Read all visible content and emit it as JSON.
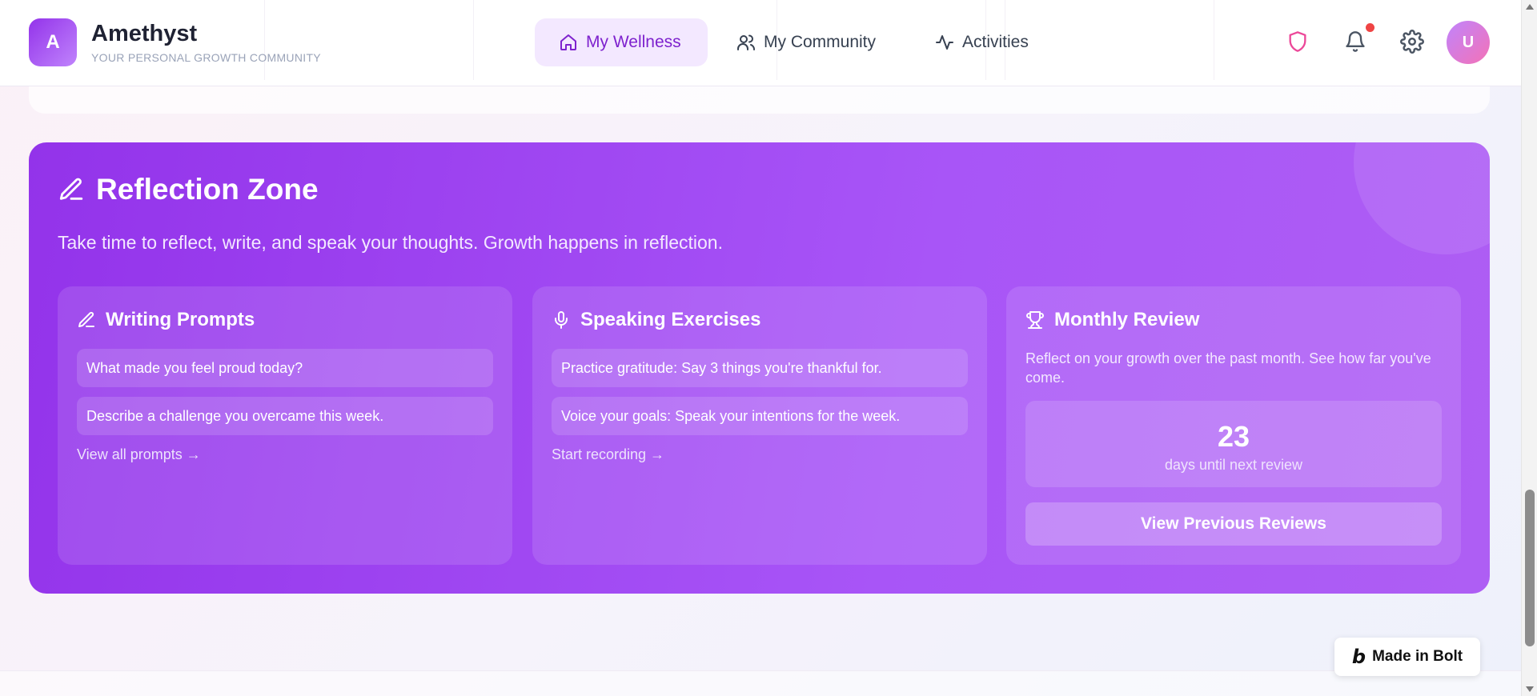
{
  "header": {
    "logo_letter": "A",
    "brand_name": "Amethyst",
    "brand_tagline": "YOUR PERSONAL GROWTH COMMUNITY",
    "nav": [
      {
        "label": "My Wellness",
        "icon": "home-icon",
        "active": true
      },
      {
        "label": "My Community",
        "icon": "users-icon",
        "active": false
      },
      {
        "label": "Activities",
        "icon": "activity-icon",
        "active": false
      }
    ],
    "icons": [
      "shield-icon",
      "bell-icon",
      "gear-icon"
    ],
    "avatar_letter": "U",
    "notification_dot": true
  },
  "reflection_zone": {
    "icon": "pencil-icon",
    "title": "Reflection Zone",
    "subtitle": "Take time to reflect, write, and speak your thoughts. Growth happens in reflection.",
    "cards": {
      "writing": {
        "icon": "pencil-icon",
        "title": "Writing Prompts",
        "items": [
          "What made you feel proud today?",
          "Describe a challenge you overcame this week."
        ],
        "link": "View all prompts →"
      },
      "speaking": {
        "icon": "microphone-icon",
        "title": "Speaking Exercises",
        "items": [
          "Practice gratitude: Say 3 things you're thankful for.",
          "Voice your goals: Speak your intentions for the week."
        ],
        "link": "Start recording →"
      },
      "review": {
        "icon": "trophy-icon",
        "title": "Monthly Review",
        "description": "Reflect on your growth over the past month. See how far you've come.",
        "count": "23",
        "count_label": "days until next review",
        "button": "View Previous Reviews"
      }
    }
  },
  "badge": {
    "mark": "b",
    "label": "Made in Bolt"
  },
  "colors": {
    "accent": "#9333ea",
    "accent_light": "#a855f7",
    "nav_active_bg": "#f3e8ff",
    "nav_active_text": "#7e22ce",
    "shield": "#ec4899",
    "notification": "#ef4444"
  }
}
